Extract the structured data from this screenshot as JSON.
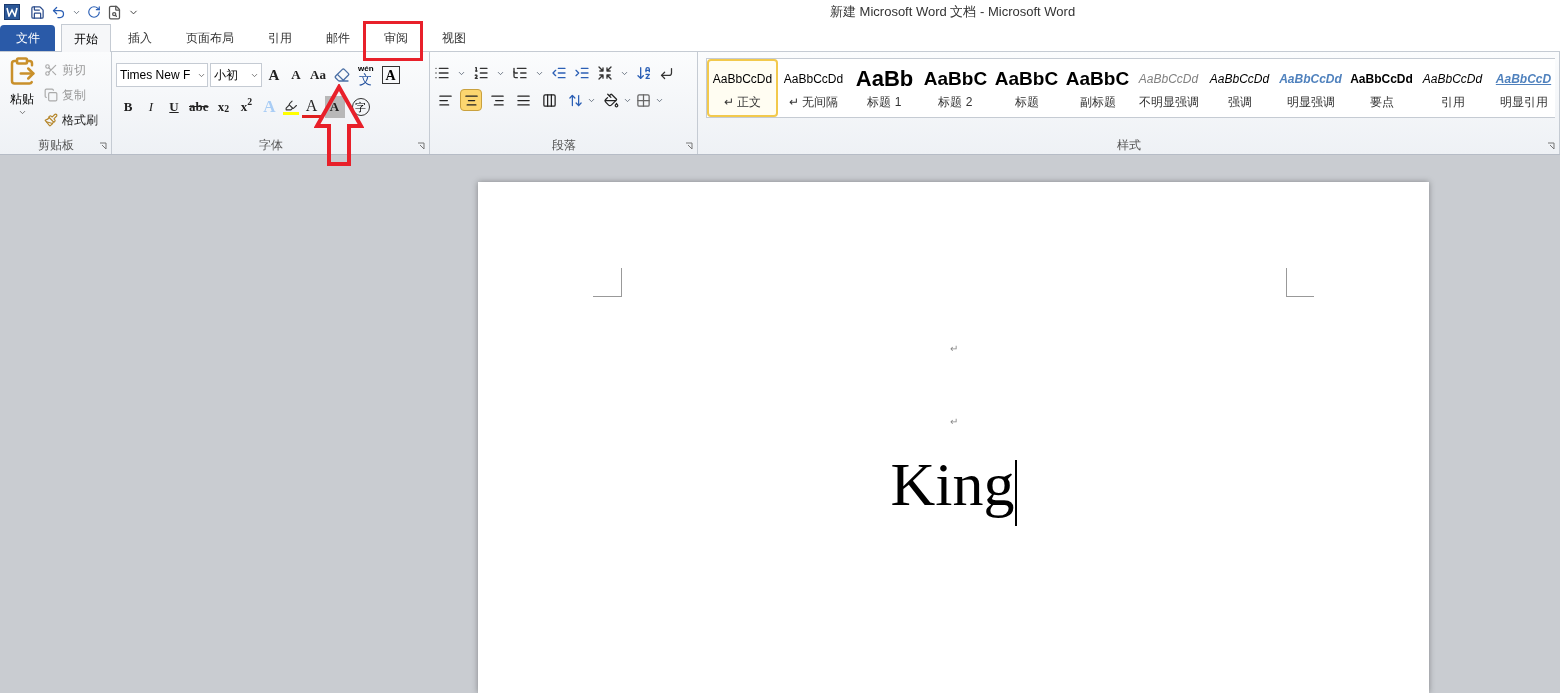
{
  "window": {
    "title": "新建 Microsoft Word 文档 - Microsoft Word"
  },
  "tabs": [
    {
      "label": "文件",
      "kind": "file",
      "selected": false,
      "annotated": false
    },
    {
      "label": "开始",
      "kind": "tab",
      "selected": true,
      "annotated": false
    },
    {
      "label": "插入",
      "kind": "tab",
      "selected": false,
      "annotated": false
    },
    {
      "label": "页面布局",
      "kind": "tab",
      "selected": false,
      "annotated": false
    },
    {
      "label": "引用",
      "kind": "tab",
      "selected": false,
      "annotated": false
    },
    {
      "label": "邮件",
      "kind": "tab",
      "selected": false,
      "annotated": false
    },
    {
      "label": "审阅",
      "kind": "tab",
      "selected": false,
      "annotated": true
    },
    {
      "label": "视图",
      "kind": "tab",
      "selected": false,
      "annotated": false
    }
  ],
  "clipboard": {
    "paste": "粘贴",
    "items": [
      {
        "label": "剪切",
        "kind": "cut",
        "disabled": true
      },
      {
        "label": "复制",
        "kind": "copy",
        "disabled": true
      },
      {
        "label": "格式刷",
        "kind": "painter",
        "disabled": false
      }
    ],
    "group_label": "剪贴板"
  },
  "font": {
    "font_name": "Times New F",
    "font_size": "小初",
    "group_label": "字体",
    "row1": [
      {
        "kind": "grow",
        "glyph": "A"
      },
      {
        "kind": "shrink",
        "glyph": "A"
      },
      {
        "kind": "case",
        "glyph": "Aa"
      },
      {
        "kind": "clear",
        "annotated": true
      },
      {
        "kind": "phonetic",
        "glyph": "文",
        "ruby": "wén"
      },
      {
        "kind": "border",
        "glyph": "A"
      }
    ],
    "row2": [
      {
        "kind": "bold",
        "glyph": "B"
      },
      {
        "kind": "italic",
        "glyph": "I"
      },
      {
        "kind": "underline",
        "glyph": "U"
      },
      {
        "kind": "strike",
        "glyph": "abe"
      },
      {
        "kind": "sub",
        "glyph": "x$_{2}$"
      },
      {
        "kind": "sup",
        "glyph": "x$^{2}$"
      },
      {
        "kind": "effect",
        "glyph": "A"
      },
      {
        "kind": "highlight"
      },
      {
        "kind": "color",
        "glyph": "A"
      },
      {
        "kind": "shading",
        "glyph": "A"
      },
      {
        "kind": "enclose",
        "glyph": "字"
      }
    ]
  },
  "paragraph": {
    "group_label": "段落",
    "align": [
      {
        "kind": "left",
        "selected": false
      },
      {
        "kind": "center",
        "selected": true
      },
      {
        "kind": "right",
        "selected": false
      },
      {
        "kind": "justify",
        "selected": false
      },
      {
        "kind": "distribute",
        "selected": false
      }
    ]
  },
  "styles": {
    "group_label": "样式",
    "items": [
      {
        "preview": "AaBbCcDd",
        "label": "正文",
        "para_mark": "↵",
        "kind": "normal",
        "selected": true
      },
      {
        "preview": "AaBbCcDd",
        "label": "无间隔",
        "para_mark": "↵",
        "kind": "normal",
        "selected": false
      },
      {
        "preview": "AaBb",
        "label": "标题 1",
        "kind": "heading1",
        "selected": false
      },
      {
        "preview": "AaBbC",
        "label": "标题 2",
        "kind": "heading2",
        "selected": false
      },
      {
        "preview": "AaBbC",
        "label": "标题",
        "kind": "title",
        "selected": false
      },
      {
        "preview": "AaBbC",
        "label": "副标题",
        "kind": "subtitle",
        "selected": false
      },
      {
        "preview": "AaBbCcDd",
        "label": "不明显强调",
        "kind": "subtle",
        "selected": false
      },
      {
        "preview": "AaBbCcDd",
        "label": "强调",
        "kind": "emphasis",
        "selected": false
      },
      {
        "preview": "AaBbCcDd",
        "label": "明显强调",
        "kind": "intense",
        "selected": false
      },
      {
        "preview": "AaBbCcDd",
        "label": "要点",
        "kind": "strong",
        "selected": false
      },
      {
        "preview": "AaBbCcDd",
        "label": "引用",
        "kind": "quote",
        "selected": false
      },
      {
        "preview": "AaBbCcD",
        "label": "明显引用",
        "kind": "intense_quote",
        "selected": false
      }
    ]
  },
  "document": {
    "paragraphs": [
      {
        "kind": "mark",
        "text": "↵"
      },
      {
        "kind": "mark",
        "text": "↵"
      },
      {
        "kind": "title",
        "text": "King"
      }
    ]
  }
}
